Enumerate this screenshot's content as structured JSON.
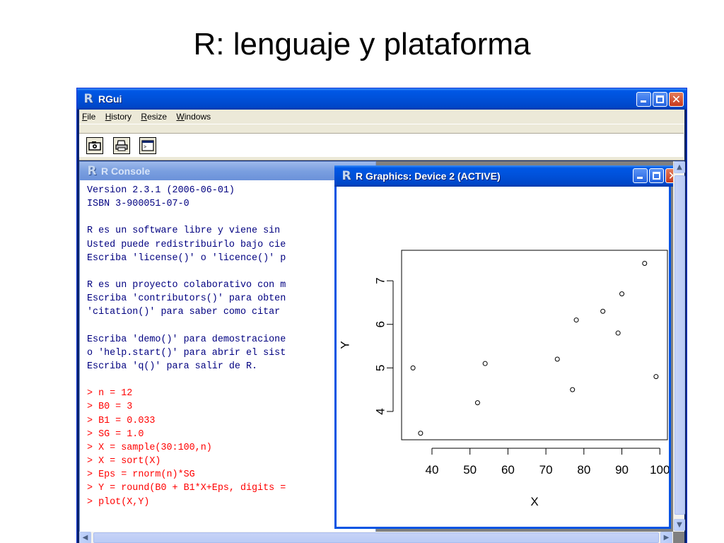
{
  "slide": {
    "title": "R: lenguaje y plataforma"
  },
  "rgui": {
    "title": "RGui",
    "menu": [
      "File",
      "History",
      "Resize",
      "Windows"
    ],
    "toolbar_icons": [
      "camera-icon",
      "print-icon",
      "console-window-icon"
    ]
  },
  "console": {
    "title": "R Console",
    "lines": [
      {
        "text": "Version 2.3.1 (2006-06-01)",
        "kind": "out"
      },
      {
        "text": "ISBN 3-900051-07-0",
        "kind": "out"
      },
      {
        "text": "",
        "kind": "gap"
      },
      {
        "text": "R es un software libre y viene sin",
        "kind": "out"
      },
      {
        "text": "Usted puede redistribuirlo bajo cie",
        "kind": "out"
      },
      {
        "text": "Escriba 'license()' o 'licence()' p",
        "kind": "out"
      },
      {
        "text": "",
        "kind": "gap"
      },
      {
        "text": "R es un proyecto colaborativo con m",
        "kind": "out"
      },
      {
        "text": "Escriba 'contributors()' para obten",
        "kind": "out"
      },
      {
        "text": "'citation()' para saber como citar",
        "kind": "out"
      },
      {
        "text": "",
        "kind": "gap"
      },
      {
        "text": "Escriba 'demo()' para demostracione",
        "kind": "out"
      },
      {
        "text": "o 'help.start()' para abrir el sist",
        "kind": "out"
      },
      {
        "text": "Escriba 'q()' para salir de R.",
        "kind": "out"
      },
      {
        "text": "",
        "kind": "gap"
      },
      {
        "text": "> n = 12",
        "kind": "cmd"
      },
      {
        "text": "> B0 = 3",
        "kind": "cmd"
      },
      {
        "text": "> B1 = 0.033",
        "kind": "cmd"
      },
      {
        "text": "> SG = 1.0",
        "kind": "cmd"
      },
      {
        "text": "> X = sample(30:100,n)",
        "kind": "cmd"
      },
      {
        "text": "> X = sort(X)",
        "kind": "cmd"
      },
      {
        "text": "> Eps = rnorm(n)*SG",
        "kind": "cmd"
      },
      {
        "text": "> Y = round(B0 + B1*X+Eps, digits =",
        "kind": "cmd"
      },
      {
        "text": "> plot(X,Y)",
        "kind": "cmd"
      }
    ]
  },
  "graphics": {
    "title": "R Graphics: Device 2 (ACTIVE)"
  },
  "chart_data": {
    "type": "scatter",
    "title": "",
    "xlabel": "X",
    "ylabel": "Y",
    "xlim": [
      32,
      102
    ],
    "ylim": [
      3.35,
      7.7
    ],
    "xticks": [
      40,
      50,
      60,
      70,
      80,
      90,
      100
    ],
    "yticks": [
      4,
      5,
      6,
      7
    ],
    "marker": "open-circle",
    "grid": false,
    "points": [
      {
        "x": 35,
        "y": 5.0
      },
      {
        "x": 37,
        "y": 3.5
      },
      {
        "x": 52,
        "y": 4.2
      },
      {
        "x": 54,
        "y": 5.1
      },
      {
        "x": 73,
        "y": 5.2
      },
      {
        "x": 77,
        "y": 4.5
      },
      {
        "x": 78,
        "y": 6.1
      },
      {
        "x": 85,
        "y": 6.3
      },
      {
        "x": 89,
        "y": 5.8
      },
      {
        "x": 90,
        "y": 6.7
      },
      {
        "x": 96,
        "y": 7.4
      },
      {
        "x": 99,
        "y": 4.8
      }
    ]
  }
}
